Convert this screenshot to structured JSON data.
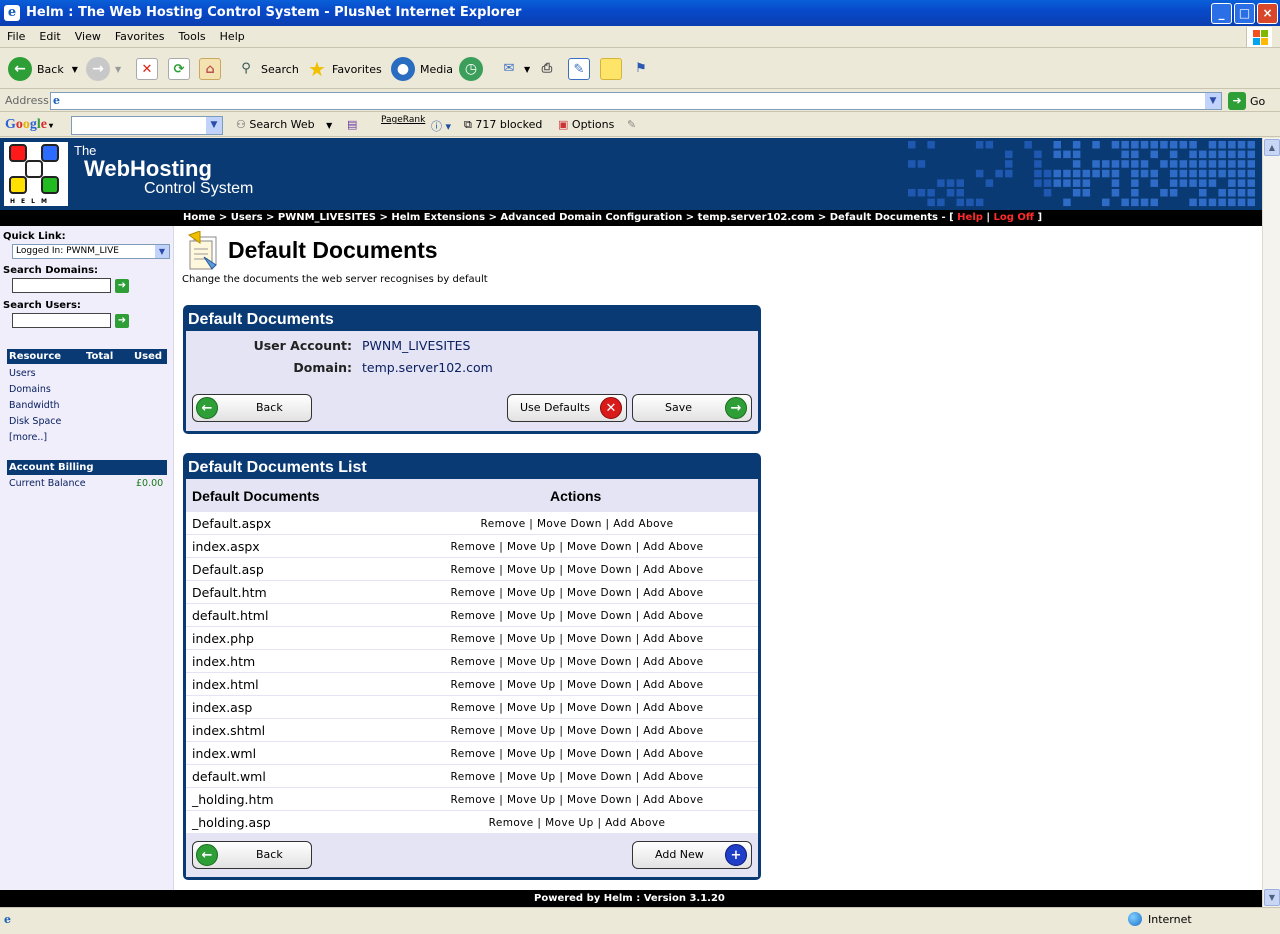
{
  "window": {
    "title": "Helm : The Web Hosting Control System - PlusNet Internet Explorer",
    "controls": {
      "minimize": "_",
      "maximize": "□",
      "close": "×"
    }
  },
  "menu": [
    "File",
    "Edit",
    "View",
    "Favorites",
    "Tools",
    "Help"
  ],
  "toolbar": {
    "back": "Back",
    "search": "Search",
    "favorites": "Favorites",
    "media": "Media"
  },
  "address": {
    "label": "Address",
    "value": "",
    "go": "Go"
  },
  "google_bar": {
    "logo": "Google",
    "search_web": "Search Web",
    "pagerank": "PageRank",
    "blocked": "717 blocked",
    "options": "Options"
  },
  "helm": {
    "brand_line1": "The",
    "brand_line2": "WebHosting",
    "brand_line3": "Control System",
    "logo_letters": "HELM",
    "logo_colors": [
      "#ff1a1a",
      "#2b6bff",
      "#ffe000",
      "#22bb22"
    ]
  },
  "breadcrumb": {
    "path": "Home > Users > PWNM_LIVESITES > Helm Extensions > Advanced Domain Configuration > temp.server102.com > Default Documents - [ ",
    "help": "Help",
    "sep": " | ",
    "logoff": "Log Off",
    "end": " ]"
  },
  "sidebar": {
    "quick_link_label": "Quick Link:",
    "quick_link_value": "Logged In: PWNM_LIVE",
    "search_domains_label": "Search Domains:",
    "search_users_label": "Search Users:",
    "resource_header": {
      "resource": "Resource",
      "total": "Total",
      "used": "Used"
    },
    "resources": [
      "Users",
      "Domains",
      "Bandwidth",
      "Disk Space",
      "[more..]"
    ],
    "billing_header": "Account Billing",
    "billing_label": "Current Balance",
    "billing_value": "£0.00"
  },
  "page": {
    "title": "Default Documents",
    "subtitle": "Change the documents the web server recognises by default"
  },
  "details_panel": {
    "title": "Default Documents",
    "user_account_label": "User Account:",
    "user_account_value": "PWNM_LIVESITES",
    "domain_label": "Domain:",
    "domain_value": "temp.server102.com",
    "back": "Back",
    "use_defaults": "Use Defaults",
    "save": "Save"
  },
  "list_panel": {
    "title": "Default Documents List",
    "col_documents": "Default Documents",
    "col_actions": "Actions",
    "rows": [
      {
        "name": "Default.aspx",
        "actions": "Remove | Move Down | Add Above"
      },
      {
        "name": "index.aspx",
        "actions": "Remove | Move Up | Move Down | Add Above"
      },
      {
        "name": "Default.asp",
        "actions": "Remove | Move Up | Move Down | Add Above"
      },
      {
        "name": "Default.htm",
        "actions": "Remove | Move Up | Move Down | Add Above"
      },
      {
        "name": "default.html",
        "actions": "Remove | Move Up | Move Down | Add Above"
      },
      {
        "name": "index.php",
        "actions": "Remove | Move Up | Move Down | Add Above"
      },
      {
        "name": "index.htm",
        "actions": "Remove | Move Up | Move Down | Add Above"
      },
      {
        "name": "index.html",
        "actions": "Remove | Move Up | Move Down | Add Above"
      },
      {
        "name": "index.asp",
        "actions": "Remove | Move Up | Move Down | Add Above"
      },
      {
        "name": "index.shtml",
        "actions": "Remove | Move Up | Move Down | Add Above"
      },
      {
        "name": "index.wml",
        "actions": "Remove | Move Up | Move Down | Add Above"
      },
      {
        "name": "default.wml",
        "actions": "Remove | Move Up | Move Down | Add Above"
      },
      {
        "name": "_holding.htm",
        "actions": "Remove | Move Up | Move Down | Add Above"
      },
      {
        "name": "_holding.asp",
        "actions": "Remove | Move Up | Add Above"
      }
    ],
    "back": "Back",
    "add_new": "Add New"
  },
  "footer": "Powered by Helm  :  Version 3.1.20",
  "status": {
    "zone": "Internet"
  }
}
